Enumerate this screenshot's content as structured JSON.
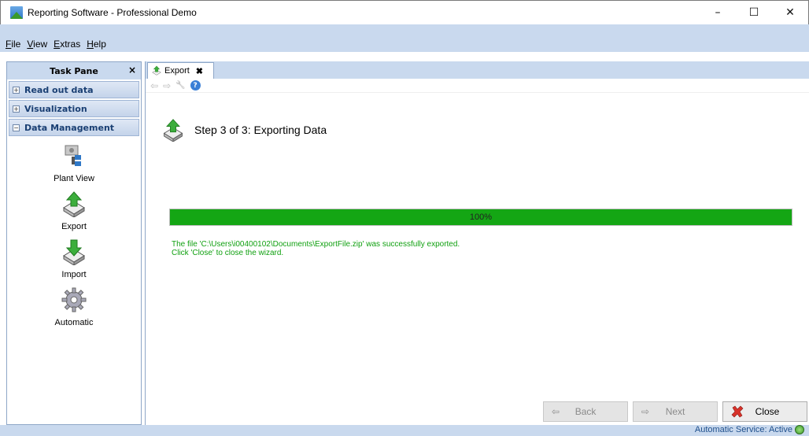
{
  "window": {
    "title": "Reporting Software - Professional Demo",
    "minimize": "–",
    "maximize": "☐",
    "close": "✕"
  },
  "menu": {
    "items": [
      {
        "first": "F",
        "rest": "ile"
      },
      {
        "first": "V",
        "rest": "iew"
      },
      {
        "first": "E",
        "rest": "xtras"
      },
      {
        "first": "H",
        "rest": "elp"
      }
    ]
  },
  "taskpane": {
    "title": "Task Pane",
    "close": "×",
    "groups": [
      {
        "label": "Read out data",
        "expander": "+"
      },
      {
        "label": "Visualization",
        "expander": "+"
      },
      {
        "label": "Data Management",
        "expander": "−"
      }
    ],
    "items": [
      {
        "label": "Plant View",
        "icon": "plant-view-icon"
      },
      {
        "label": "Export",
        "icon": "export-icon"
      },
      {
        "label": "Import",
        "icon": "import-icon"
      },
      {
        "label": "Automatic",
        "icon": "gear-icon"
      }
    ]
  },
  "tab": {
    "label": "Export",
    "close": "✖"
  },
  "toolbar": {
    "back": "⇦",
    "forward": "⇨",
    "tool": "🔧",
    "help": "?"
  },
  "wizard": {
    "step": "Step 3 of 3: Exporting Data",
    "progress": 100,
    "progress_label": "100%",
    "message_line1": "The file 'C:\\Users\\i00400102\\Documents\\ExportFile.zip' was successfully exported.",
    "message_line2": "Click 'Close' to close the wizard."
  },
  "buttons": {
    "back": "Back",
    "next": "Next",
    "close": "Close",
    "back_icon": "⇦",
    "next_icon": "⇨"
  },
  "status": {
    "text": "Automatic Service: Active"
  },
  "colors": {
    "progress": "#14a614",
    "message": "#10a010",
    "chrome": "#c9d9ee"
  }
}
